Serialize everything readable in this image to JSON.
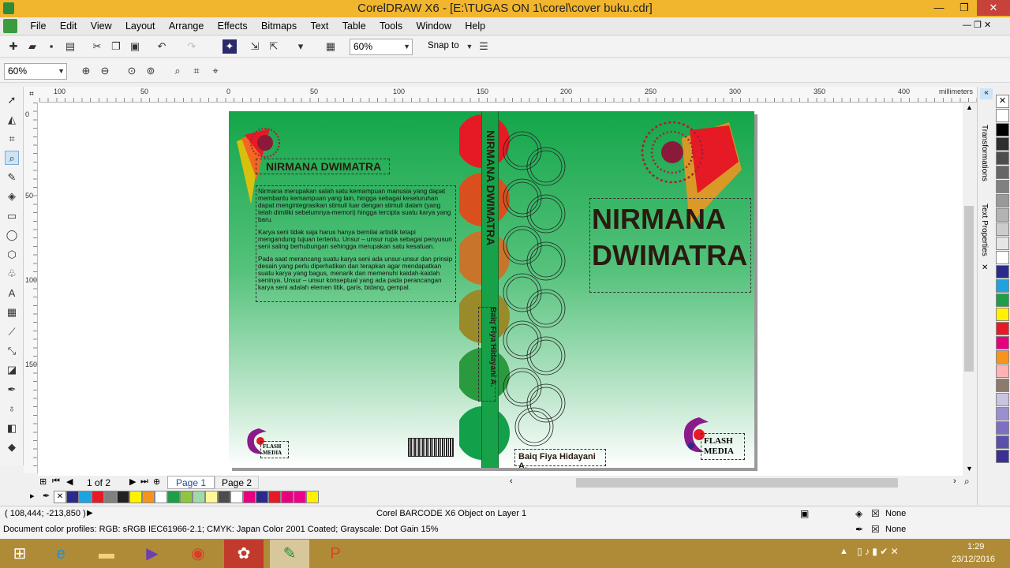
{
  "window": {
    "title": "CorelDRAW X6 - [E:\\TUGAS ON 1\\corel\\cover buku.cdr]",
    "min": "—",
    "restore": "❐",
    "close": "✕"
  },
  "menu": [
    "File",
    "Edit",
    "View",
    "Layout",
    "Arrange",
    "Effects",
    "Bitmaps",
    "Text",
    "Table",
    "Tools",
    "Window",
    "Help"
  ],
  "toolbar": {
    "zoom_value": "60%",
    "snap_label": "Snap to"
  },
  "propbar": {
    "zoom_value": "60%"
  },
  "ruler": {
    "units": "millimeters",
    "top_ticks": [
      "100",
      "50",
      "0",
      "50",
      "100",
      "150",
      "200",
      "250",
      "300",
      "350",
      "400"
    ],
    "left_ticks": [
      "0",
      "50",
      "100",
      "150"
    ]
  },
  "cover": {
    "back_title": "NIRMANA DWIMATRA",
    "para1": "Nirmana merupakan salah satu kemampuan manusia yang dapat membantu kemampuan yang lain, hingga sebagai keseluruhan dapat mengintegrasikan stimuli luar dengan stimuli dalam (yang telah dimiliki sebelumnya-memori) hingga tercipta suatu karya yang baru.",
    "para2": "Karya seni tidak saja harus hanya bernilai artistik tetapi mengandung tujuan tertentu. Unsur – unsur rupa sebagai penyusun seni saling berhubungan sehingga merupakan satu kesatuan.",
    "para3": "Pada saat merancang suatu karya seni ada unsur-unsur dan prinsip desain yang perlu diperhatikan dan terapkan agar mendapatkan suatu karya yang bagus, menarik dan memenuhi kaidah-kaidah seninya. Unsur – unsur konseptual yang ada pada perancangan karya seni adalah elemen titik, garis, bidang, gempal.",
    "spine_title": "NIRMANA DWIMATRA",
    "spine_author": "Baiq Fiya Hidayani A.",
    "front_title_1": "NIRMANA",
    "front_title_2": "DWIMATRA",
    "author": "Baiq Fiya Hidayani A.",
    "publisher_1": "FLASH",
    "publisher_2": "MEDIA"
  },
  "pages": {
    "counter": "1 of 2",
    "tabs": [
      "Page 1",
      "Page 2"
    ]
  },
  "dockers": {
    "transformations": "Transformations",
    "text_properties": "Text Properties"
  },
  "status": {
    "coords": "( 108,444; -213,850 )",
    "object": "Corel BARCODE X6 Object on Layer 1",
    "fill": "None",
    "outline": "None",
    "profiles": "Document color profiles: RGB: sRGB IEC61966-2.1; CMYK: Japan Color 2001 Coated; Grayscale: Dot Gain 15%"
  },
  "clock": {
    "time": "1:29",
    "date": "23/12/2016"
  },
  "palette_colors": [
    "#ffffff",
    "#000000",
    "#2e2e2e",
    "#4d4d4d",
    "#666666",
    "#808080",
    "#999999",
    "#b3b3b3",
    "#cccccc",
    "#e6e6e6",
    "#ffffff",
    "#2b2a8a",
    "#1fa3e0",
    "#1d9e47",
    "#fff200",
    "#e61a24",
    "#e6007e",
    "#f7941d",
    "#ffb3b3",
    "#8c7a6b",
    "#c9c3e0",
    "#9b8fd0",
    "#7f6fc2",
    "#5b4fae",
    "#3b3194"
  ],
  "doc_palette": [
    "#2b2a8a",
    "#1fa3e0",
    "#e61a24",
    "#808080",
    "#222222",
    "#fff200",
    "#f7941d",
    "#ffffff",
    "#1d9e47",
    "#8dc63f",
    "#a2d9a8",
    "#fff799",
    "#4d4d4d",
    "#ffffff",
    "#e6007e",
    "#2b2a8a",
    "#e61a24",
    "#e6007e",
    "#ec008c",
    "#fff200"
  ]
}
